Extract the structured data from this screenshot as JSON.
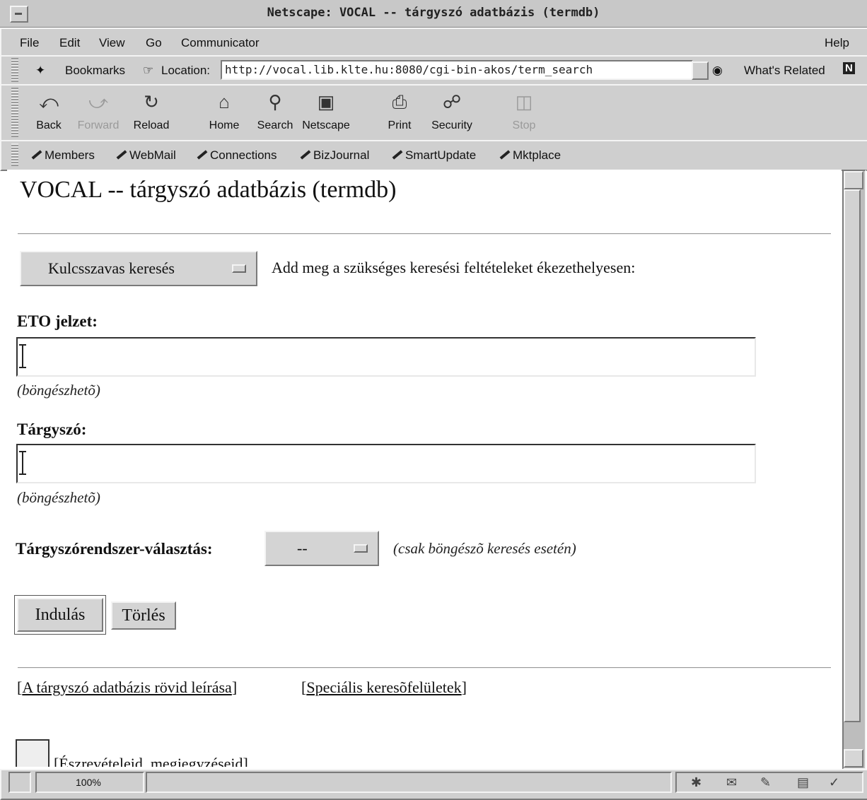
{
  "window": {
    "title": "Netscape: VOCAL -- tárgyszó adatbázis (termdb)"
  },
  "menu": {
    "file": "File",
    "edit": "Edit",
    "view": "View",
    "go": "Go",
    "communicator": "Communicator",
    "help": "Help"
  },
  "location_bar": {
    "bookmarks": "Bookmarks",
    "location_label": "Location:",
    "url": "http://vocal.lib.klte.hu:8080/cgi-bin-akos/term_search",
    "whats_related": "What's Related"
  },
  "nav": {
    "back": "Back",
    "forward": "Forward",
    "reload": "Reload",
    "home": "Home",
    "search": "Search",
    "netscape": "Netscape",
    "print": "Print",
    "security": "Security",
    "stop": "Stop"
  },
  "personal": {
    "members": "Members",
    "webmail": "WebMail",
    "connections": "Connections",
    "bizjournal": "BizJournal",
    "smartupdate": "SmartUpdate",
    "mktplace": "Mktplace"
  },
  "page": {
    "title": "VOCAL -- tárgyszó adatbázis (termdb)",
    "search_mode": "Kulcsszavas keresés",
    "instruction": "Add meg a szükséges keresési feltételeket ékezethelyesen:",
    "eto_label": "ETO jelzet:",
    "eto_value": "",
    "eto_hint": "(böngészhetõ)",
    "targyszo_label": "Tárgyszó:",
    "targyszo_value": "",
    "targyszo_hint": "(böngészhetõ)",
    "system_label": "Tárgyszórendszer-választás:",
    "system_value": "--",
    "system_hint": "(csak böngészõ keresés esetén)",
    "submit": "Indulás",
    "reset": "Törlés",
    "link_description": "A tárgyszó adatbázis rövid leírása",
    "link_special": "Speciális keresõfelületek",
    "feedback": "Észrevételeid, megjegyzéseid"
  },
  "status": {
    "zoom": "100%"
  }
}
